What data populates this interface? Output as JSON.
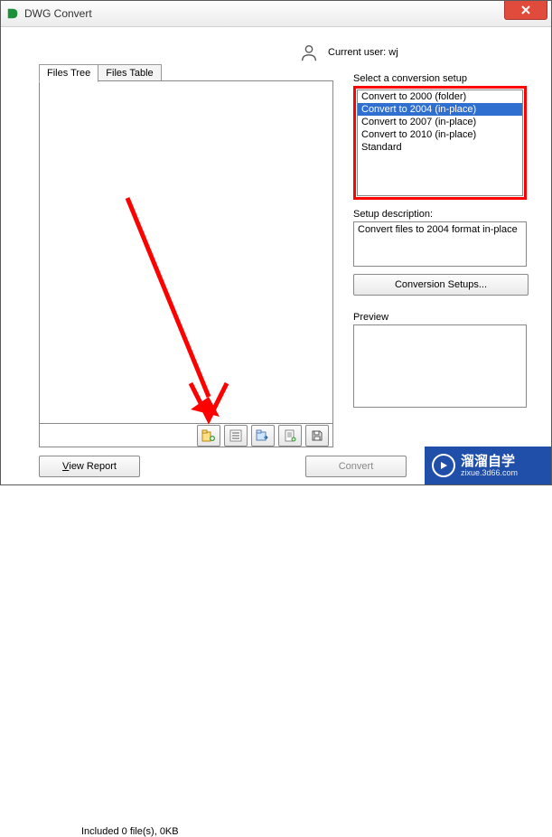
{
  "title": "DWG Convert",
  "user_label": "Current user:",
  "user_name": "wj",
  "tabs": {
    "tree": "Files Tree",
    "table": "Files Table"
  },
  "files_status": "Included 0 file(s), 0KB",
  "tool_icons": [
    "add-file-icon",
    "list-icon",
    "folder-export-icon",
    "sheet-add-icon",
    "save-icon"
  ],
  "setup_label": "Select a conversion setup",
  "setups": [
    "Convert to 2000 (folder)",
    "Convert to 2004 (in-place)",
    "Convert to 2007 (in-place)",
    "Convert to 2010 (in-place)",
    "Standard"
  ],
  "setup_selected_index": 1,
  "desc_label": "Setup description:",
  "desc_text": "Convert files to 2004 format in-place",
  "conv_setups_btn": "Conversion Setups...",
  "preview_label": "Preview",
  "btn_view_report_pre": "V",
  "btn_view_report_post": "iew Report",
  "btn_convert": "Convert",
  "watermark": {
    "cn": "溜溜自学",
    "url": "zixue.3d66.com"
  }
}
